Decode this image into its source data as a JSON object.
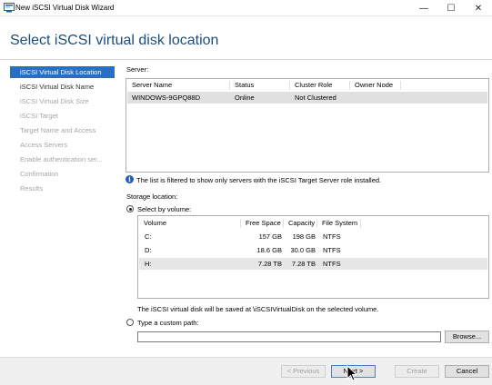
{
  "window": {
    "title": "New iSCSI Virtual Disk Wizard",
    "minimize": "—",
    "maximize": "☐",
    "close": "✕"
  },
  "page": {
    "title": "Select iSCSI virtual disk location"
  },
  "nav": {
    "items": [
      {
        "label": "iSCSI Virtual Disk Location",
        "state": "active"
      },
      {
        "label": "iSCSI Virtual Disk Name",
        "state": "enabled"
      },
      {
        "label": "iSCSI Virtual Disk Size",
        "state": "disabled"
      },
      {
        "label": "iSCSI Target",
        "state": "disabled"
      },
      {
        "label": "Target Name and Access",
        "state": "disabled"
      },
      {
        "label": "Access Servers",
        "state": "disabled"
      },
      {
        "label": "Enable authentication ser...",
        "state": "disabled"
      },
      {
        "label": "Confirmation",
        "state": "disabled"
      },
      {
        "label": "Results",
        "state": "disabled"
      }
    ]
  },
  "server": {
    "label": "Server:",
    "columns": [
      "Server Name",
      "Status",
      "Cluster Role",
      "Owner Node"
    ],
    "rows": [
      {
        "name": "WINDOWS-9GPQ88D",
        "status": "Online",
        "cluster_role": "Not Clustered",
        "owner_node": ""
      }
    ],
    "filter_note": "The list is filtered to show only servers with the iSCSI Target Server role installed."
  },
  "storage": {
    "label": "Storage location:",
    "select_by_volume_label": "Select by volume:",
    "columns": [
      "Volume",
      "Free Space",
      "Capacity",
      "File System"
    ],
    "volumes": [
      {
        "volume": "C:",
        "free": "157 GB",
        "capacity": "198 GB",
        "fs": "NTFS"
      },
      {
        "volume": "D:",
        "free": "18.6 GB",
        "capacity": "30.0 GB",
        "fs": "NTFS"
      },
      {
        "volume": "H:",
        "free": "7.28 TB",
        "capacity": "7.28 TB",
        "fs": "NTFS"
      }
    ],
    "save_note": "The iSCSI virtual disk will be saved at \\iSCSIVirtualDisk on the selected volume.",
    "custom_path_label": "Type a custom path:",
    "custom_path_value": "",
    "browse_label": "Browse..."
  },
  "footer": {
    "previous": "< Previous",
    "next": "Next >",
    "create": "Create",
    "cancel": "Cancel"
  },
  "colors": {
    "accent": "#2a6ebf",
    "title": "#1a4d7a"
  }
}
